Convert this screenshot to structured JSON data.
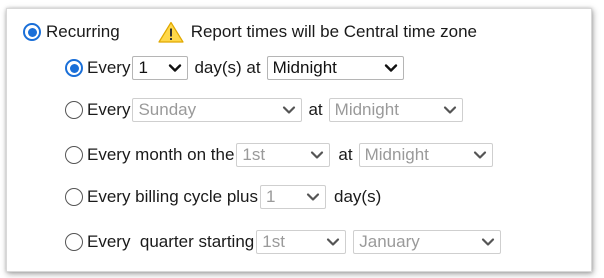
{
  "recurring": {
    "label": "Recurring",
    "warning_text": "Report times will be Central time zone",
    "icons": {
      "warning": "warning-triangle-icon",
      "dropdown": "chevron-down-icon"
    },
    "colors": {
      "accent": "#1a6fd8",
      "warning_fill": "#ffd84a",
      "disabled_text": "#9a9a9a"
    }
  },
  "options": {
    "daily": {
      "prefix": "Every",
      "count_value": "1",
      "middle": "day(s) at",
      "time_value": "Midnight"
    },
    "weekly": {
      "prefix": "Every",
      "day_value": "Sunday",
      "middle": "at",
      "time_value": "Midnight"
    },
    "monthly": {
      "prefix": "Every month on the",
      "day_value": "1st",
      "middle": "at",
      "time_value": "Midnight"
    },
    "billing": {
      "prefix": "Every billing cycle plus",
      "days_value": "1",
      "suffix": "day(s)"
    },
    "quarterly": {
      "prefix": "Every  quarter starting",
      "day_value": "1st",
      "month_value": "January"
    }
  }
}
